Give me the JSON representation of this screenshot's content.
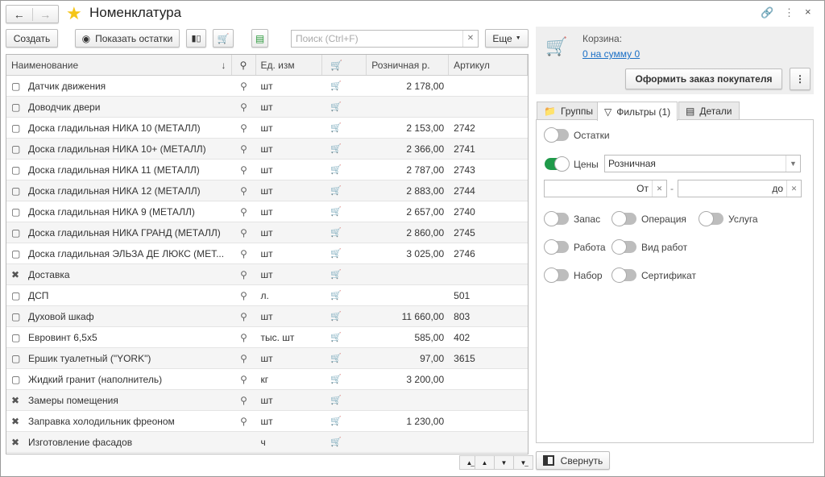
{
  "window": {
    "title": "Номенклатура"
  },
  "toolbar": {
    "create": "Создать",
    "show_stock": "Показать остатки",
    "search_placeholder": "Поиск (Ctrl+F)",
    "more": "Еще"
  },
  "table": {
    "headers": {
      "name": "Наименование",
      "unit": "Ед. изм",
      "price": "Розничная р.",
      "article": "Артикул"
    },
    "rows": [
      {
        "type": "goods",
        "name": "Датчик движения",
        "search": true,
        "unit": "шт",
        "price": "2 178,00",
        "article": ""
      },
      {
        "type": "goods",
        "name": "Доводчик двери",
        "search": true,
        "unit": "шт",
        "price": "",
        "article": ""
      },
      {
        "type": "goods",
        "name": "Доска гладильная  НИКА 10 (МЕТАЛЛ)",
        "search": true,
        "unit": "шт",
        "price": "2 153,00",
        "article": "2742"
      },
      {
        "type": "goods",
        "name": "Доска гладильная  НИКА 10+ (МЕТАЛЛ)",
        "search": true,
        "unit": "шт",
        "price": "2 366,00",
        "article": "2741"
      },
      {
        "type": "goods",
        "name": "Доска гладильная  НИКА 11 (МЕТАЛЛ)",
        "search": true,
        "unit": "шт",
        "price": "2 787,00",
        "article": "2743"
      },
      {
        "type": "goods",
        "name": "Доска гладильная  НИКА 12 (МЕТАЛЛ)",
        "search": true,
        "unit": "шт",
        "price": "2 883,00",
        "article": "2744"
      },
      {
        "type": "goods",
        "name": "Доска гладильная  НИКА 9 (МЕТАЛЛ)",
        "search": true,
        "unit": "шт",
        "price": "2 657,00",
        "article": "2740"
      },
      {
        "type": "goods",
        "name": "Доска гладильная  НИКА ГРАНД (МЕТАЛЛ)",
        "search": true,
        "unit": "шт",
        "price": "2 860,00",
        "article": "2745"
      },
      {
        "type": "goods",
        "name": "Доска гладильная  ЭЛЬЗА ДЕ ЛЮКС (МЕТ...",
        "search": true,
        "unit": "шт",
        "price": "3 025,00",
        "article": "2746"
      },
      {
        "type": "service",
        "name": "Доставка",
        "search": true,
        "unit": "шт",
        "price": "",
        "article": ""
      },
      {
        "type": "goods",
        "name": "ДСП",
        "search": true,
        "unit": "л.",
        "price": "",
        "article": "501"
      },
      {
        "type": "goods",
        "name": "Духовой шкаф",
        "search": true,
        "unit": "шт",
        "price": "11 660,00",
        "article": "803"
      },
      {
        "type": "goods",
        "name": "Евровинт 6,5х5",
        "search": true,
        "unit": "тыс. шт",
        "price": "585,00",
        "article": "402"
      },
      {
        "type": "goods",
        "name": "Ершик туалетный (\"YORK\")",
        "search": true,
        "unit": "шт",
        "price": "97,00",
        "article": "3615"
      },
      {
        "type": "goods",
        "name": "Жидкий гранит (наполнитель)",
        "search": true,
        "unit": "кг",
        "price": "3 200,00",
        "article": ""
      },
      {
        "type": "service",
        "name": "Замеры помещения",
        "search": true,
        "unit": "шт",
        "price": "",
        "article": ""
      },
      {
        "type": "service",
        "name": "Заправка холодильник фреоном",
        "search": true,
        "unit": "шт",
        "price": "1 230,00",
        "article": ""
      },
      {
        "type": "service",
        "name": "Изготовление фасадов",
        "search": false,
        "unit": "ч",
        "price": "",
        "article": ""
      }
    ]
  },
  "cart": {
    "label": "Корзина:",
    "link": "0 на сумму 0",
    "order_button": "Оформить заказ покупателя"
  },
  "tabs": [
    {
      "label": "Группы"
    },
    {
      "label": "Фильтры (1)"
    },
    {
      "label": "Детали"
    }
  ],
  "filters": {
    "stock": {
      "label": "Остатки",
      "on": false
    },
    "prices": {
      "label": "Цены",
      "on": true,
      "value": "Розничная"
    },
    "from": "От",
    "to": "до",
    "dash": "-",
    "toggles": [
      {
        "label": "Запас",
        "on": false
      },
      {
        "label": "Операция",
        "on": false
      },
      {
        "label": "Услуга",
        "on": false
      },
      {
        "label": "Работа",
        "on": false
      },
      {
        "label": "Вид работ",
        "on": false
      },
      {
        "label": "Набор",
        "on": false
      },
      {
        "label": "Сертификат",
        "on": false
      }
    ]
  },
  "collapse_button": "Свернуть",
  "colors": {
    "accent": "#1f9a4a",
    "link": "#1a6fc6",
    "star": "#f5c518"
  }
}
